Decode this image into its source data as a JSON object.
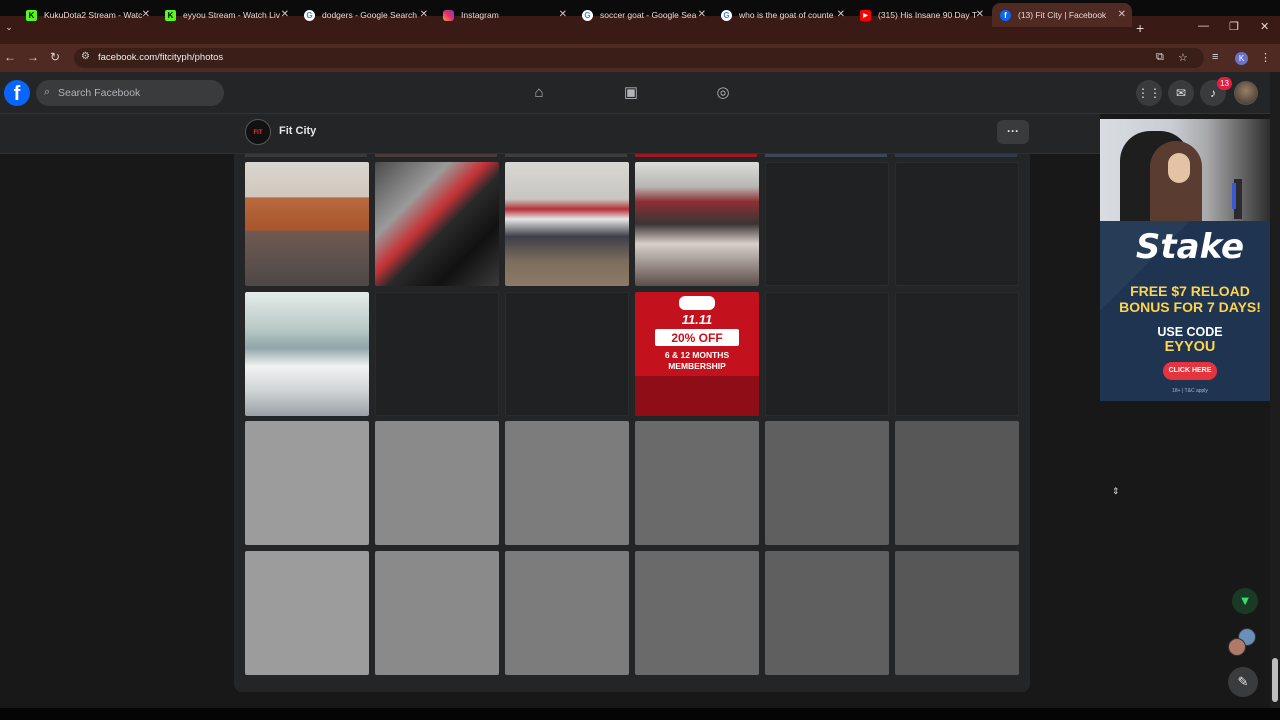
{
  "browser": {
    "tabs": [
      {
        "title": "KukuDota2 Stream - Watc",
        "icon": "kick-icon",
        "color": "#53fc18"
      },
      {
        "title": "eyyou Stream - Watch Liv",
        "icon": "kick-icon",
        "color": "#53fc18"
      },
      {
        "title": "dodgers - Google Search",
        "icon": "google-icon",
        "color": "#ffffff"
      },
      {
        "title": "Instagram",
        "icon": "instagram-icon",
        "color": "#e1306c"
      },
      {
        "title": "soccer goat - Google Sea",
        "icon": "google-icon",
        "color": "#ffffff"
      },
      {
        "title": "who is the goat of counte",
        "icon": "google-icon",
        "color": "#ffffff"
      },
      {
        "title": "(315) His Insane 90 Day T",
        "icon": "youtube-icon",
        "color": "#ff0000"
      },
      {
        "title": "(13) Fit City | Facebook",
        "icon": "facebook-icon",
        "color": "#0866ff"
      }
    ],
    "url": "facebook.com/fitcityph/photos",
    "profile_initial": "K"
  },
  "facebook": {
    "logo": "f",
    "search_placeholder": "Search Facebook",
    "notification_count": "13"
  },
  "page": {
    "name": "Fit City",
    "logo_text": "FIT CITY",
    "more_label": "···"
  },
  "promo_post": {
    "date": "11.11",
    "discount": "20% OFF",
    "line1": "6 & 12 MONTHS",
    "line2": "MEMBERSHIP"
  },
  "ad": {
    "brand": "Stake",
    "headline1": "FREE $7 RELOAD",
    "headline2": "BONUS FOR 7 DAYS!",
    "use_code": "USE CODE",
    "code": "EYYOU",
    "cta": "CLICK HERE",
    "fine_print": "18+ | T&C apply"
  },
  "colors": {
    "tab_strip": "#3a1a14",
    "fb_blue": "#0866ff",
    "promo_red": "#c3121e",
    "ad_blue": "#1f3550"
  }
}
